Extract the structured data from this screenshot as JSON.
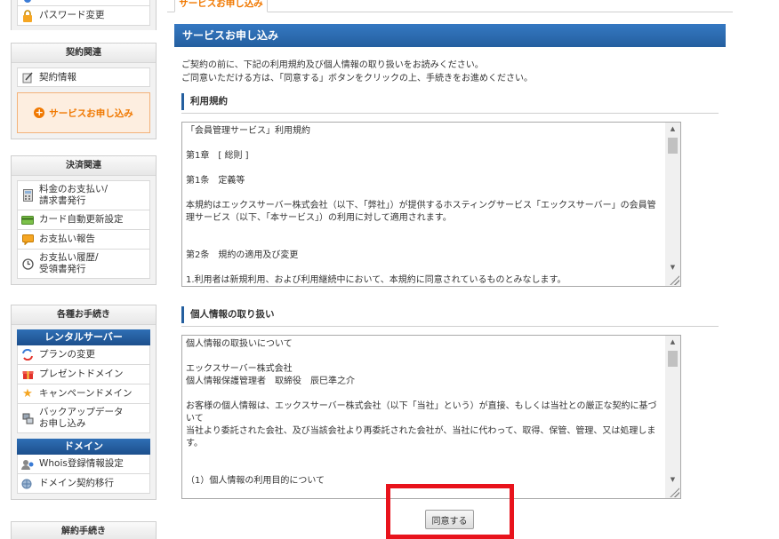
{
  "sidebar": {
    "account_items": [
      {
        "label": "パスワード変更",
        "icon": "lock-icon"
      }
    ],
    "contract": {
      "heading": "契約関連",
      "items": [
        {
          "label": "契約情報",
          "icon": "contract-doc-icon"
        }
      ],
      "highlight_label": "サービスお申し込み"
    },
    "payment": {
      "heading": "決済関連",
      "items": [
        {
          "label": "料金のお支払い/",
          "label2": "請求書発行",
          "icon": "calculator-icon"
        },
        {
          "label": "カード自動更新設定",
          "icon": "credit-card-icon"
        },
        {
          "label": "お支払い報告",
          "icon": "report-icon"
        },
        {
          "label": "お支払い履歴/",
          "label2": "受領書発行",
          "icon": "clock-icon"
        }
      ]
    },
    "procedures": {
      "heading": "各種お手続き",
      "rental": {
        "heading": "レンタルサーバー",
        "items": [
          {
            "label": "プランの変更",
            "icon": "plan-change-icon"
          },
          {
            "label": "プレゼントドメイン",
            "icon": "gift-icon"
          },
          {
            "label": "キャンペーンドメイン",
            "icon": "star-icon"
          },
          {
            "label": "バックアップデータ",
            "label2": "お申し込み",
            "icon": "backup-icon"
          }
        ]
      },
      "domain": {
        "heading": "ドメイン",
        "items": [
          {
            "label": "Whois登録情報設定",
            "icon": "whois-icon"
          },
          {
            "label": "ドメイン契約移行",
            "icon": "domain-transfer-icon"
          }
        ]
      }
    },
    "cancel": {
      "heading": "解約手続き"
    }
  },
  "main": {
    "tab_label": "サービスお申し込み",
    "title": "サービスお申し込み",
    "intro": [
      "ご契約の前に、下記の利用規約及び個人情報の取り扱いをお読みください。",
      "ご同意いただける方は、「同意する」ボタンをクリックの上、手続きをお進めください。"
    ],
    "terms": {
      "heading": "利用規約",
      "lines": [
        "「会員管理サービス」利用規約",
        "",
        "第1章　[ 総則 ]",
        "",
        "第1条　定義等",
        "",
        "本規約はエックスサーバー株式会社（以下、「弊社」）が提供するホスティングサービス「エックスサーバー」の会員管理サービス（以下、「本サービス」）の利用に対して適用されます。",
        "",
        "",
        "第2条　規約の適用及び変更",
        "",
        "1.利用者は新規利用、および利用継続中において、本規約に同意されているものとみなします。"
      ]
    },
    "privacy": {
      "heading": "個人情報の取り扱い",
      "lines": [
        "個人情報の取扱いについて",
        "",
        "エックスサーバー株式会社",
        "個人情報保護管理者　取締役　辰巳準之介",
        "",
        "お客様の個人情報は、エックスサーバー株式会社（以下「当社」という）が直接、もしくは当社との厳正な契約に基づいて",
        "当社より委託された会社、及び当該会社より再委託された会社が、当社に代わって、取得、保管、管理、又は処理します。",
        "",
        "",
        "（1）個人情報の利用目的について"
      ]
    },
    "agree_label": "同意する"
  },
  "colors": {
    "accent_blue": "#245f9f",
    "accent_orange": "#f07800",
    "highlight_red": "#e8131c"
  }
}
